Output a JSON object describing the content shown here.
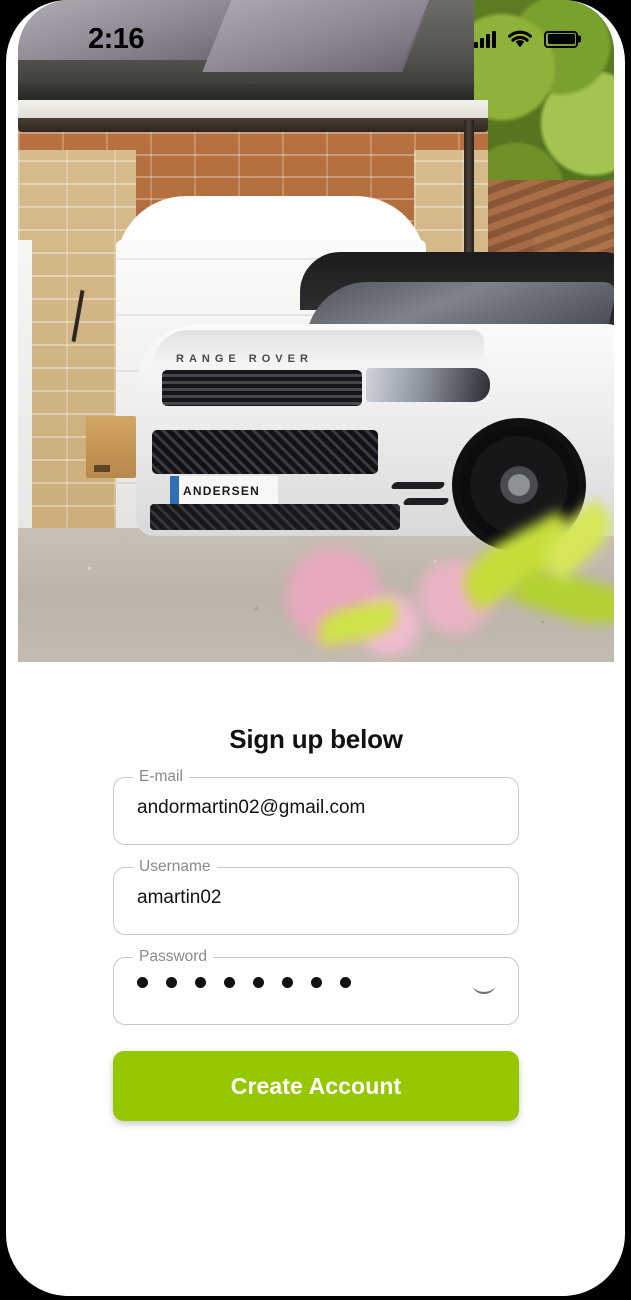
{
  "status_bar": {
    "time": "2:16",
    "cellular_icon": "cellular-signal-icon",
    "wifi_icon": "wifi-icon",
    "battery_icon": "battery-full-icon"
  },
  "hero": {
    "icon": "hero-photo",
    "description": "White Range Rover parked on a gravel driveway in front of a brick house with a white garage door and rooftop solar panels",
    "car_brand_text": "RANGE ROVER",
    "license_plate_text": "ANDERSEN"
  },
  "form": {
    "heading": "Sign up below",
    "fields": [
      {
        "name": "email",
        "label": "E-mail",
        "value": "andormartin02@gmail.com",
        "placeholder": "E-mail"
      },
      {
        "name": "username",
        "label": "Username",
        "value": "amartin02",
        "placeholder": "Username"
      },
      {
        "name": "password",
        "label": "Password",
        "value": "••••••••",
        "placeholder": "Password",
        "masked_char_count": 8,
        "toggle_icon": "eye-closed-icon"
      }
    ],
    "submit_label": "Create Account"
  },
  "colors": {
    "accent_green": "#95c800",
    "field_border": "#c9c9c9",
    "label_text": "#8a8a8a",
    "value_text": "#121212",
    "heading_text": "#111111",
    "button_text": "#ffffff",
    "frame_black": "#000000",
    "body_white": "#ffffff"
  }
}
